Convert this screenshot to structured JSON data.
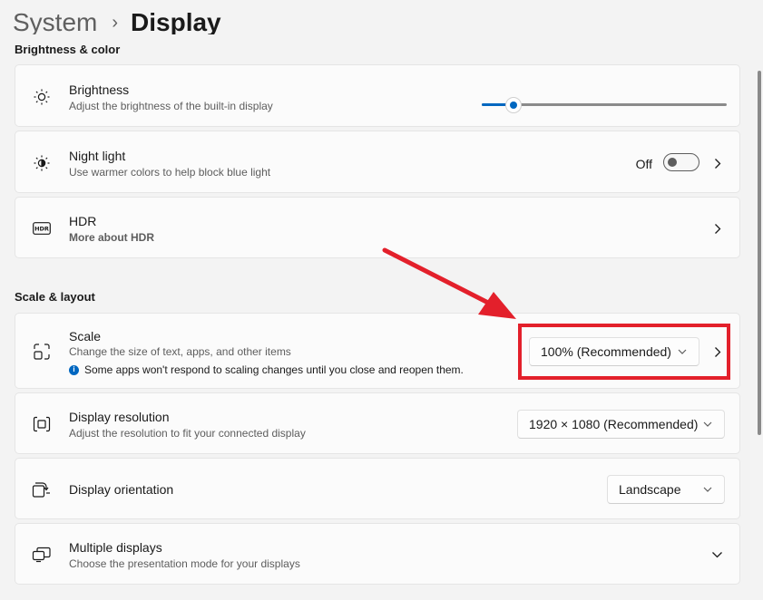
{
  "header": {
    "parent": "System",
    "separator": "›",
    "current": "Display"
  },
  "brightness_section": {
    "title": "Brightness & color"
  },
  "brightness": {
    "title": "Brightness",
    "description": "Adjust the brightness of the built-in display",
    "value_fraction": 0.13
  },
  "night_light": {
    "title": "Night light",
    "description": "Use warmer colors to help block blue light",
    "state": "Off"
  },
  "hdr": {
    "title": "HDR",
    "link": "More about HDR"
  },
  "scale_section": {
    "title": "Scale & layout"
  },
  "scale": {
    "title": "Scale",
    "description": "Change the size of text, apps, and other items",
    "info": "Some apps won't respond to scaling changes until you close and reopen them.",
    "info_icon": "i",
    "value": "100% (Recommended)"
  },
  "resolution": {
    "title": "Display resolution",
    "description": "Adjust the resolution to fit your connected display",
    "value": "1920 × 1080 (Recommended)"
  },
  "orientation": {
    "title": "Display orientation",
    "value": "Landscape"
  },
  "multiple_displays": {
    "title": "Multiple displays",
    "description": "Choose the presentation mode for your displays"
  },
  "colors": {
    "accent": "#0067c0",
    "annotation": "#e3202b",
    "link": "#0b5cad"
  },
  "icons": {
    "brightness": "sun-icon",
    "night_light": "half-sun-icon",
    "hdr": "hdr-icon",
    "scale": "scale-frame-icon",
    "resolution": "resolution-frame-icon",
    "orientation": "rotate-screen-icon",
    "multiple_displays": "multiple-monitors-icon"
  }
}
